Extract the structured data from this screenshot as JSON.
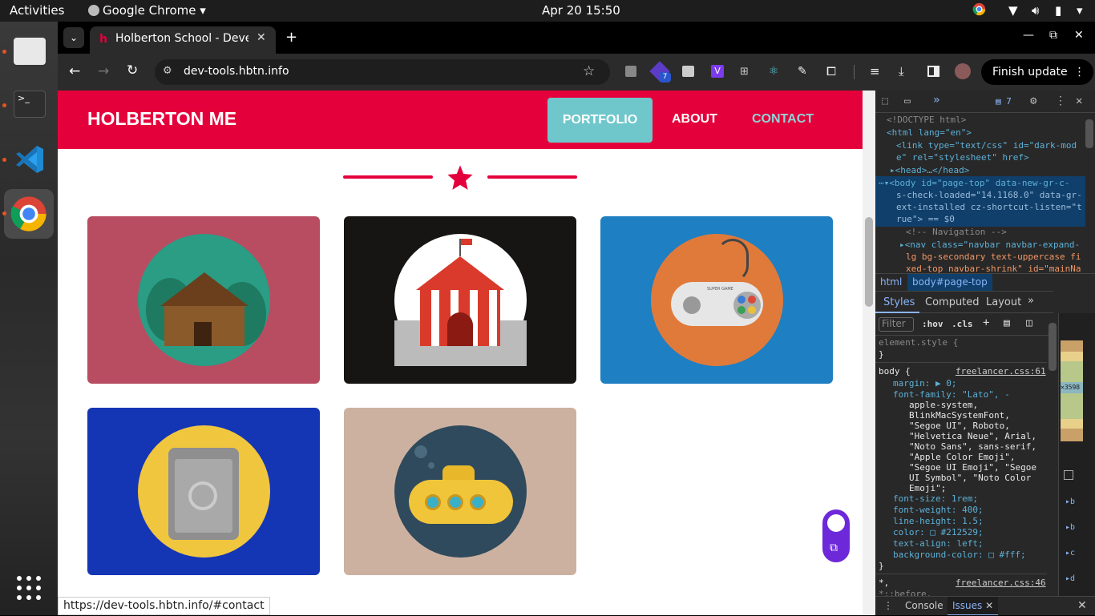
{
  "topbar": {
    "activities": "Activities",
    "app": "Google Chrome",
    "clock": "Apr 20  15:50"
  },
  "browser": {
    "tab_title": "Holberton School - Devel",
    "url": "dev-tools.hbtn.info",
    "finish_update": "Finish update",
    "extension_badge": "7",
    "status_url": "https://dev-tools.hbtn.info/#contact"
  },
  "site": {
    "brand": "HOLBERTON ME",
    "nav": [
      "PORTFOLIO",
      "ABOUT",
      "CONTACT"
    ],
    "tiles": [
      {
        "bg": "#b84d62",
        "circle": "#2a9d84",
        "icon": "cabin-icon"
      },
      {
        "bg": "#171414",
        "circle": "#ffffff",
        "icon": "circus-tent-icon"
      },
      {
        "bg": "#1e7fc2",
        "circle": "#e07a3a",
        "icon": "game-controller-icon"
      },
      {
        "bg": "#1436b5",
        "circle": "#f1c63f",
        "icon": "safe-icon"
      },
      {
        "bg": "#cdb1a0",
        "circle": "#2f4a5c",
        "icon": "submarine-icon"
      }
    ],
    "controller_label": "SUPER GAME"
  },
  "devtools": {
    "issues_count": "7",
    "elements": [
      "<!DOCTYPE html>",
      "<html lang=\"en\">",
      "<link type=\"text/css\" id=\"dark-mod",
      "e\" rel=\"stylesheet\" href>",
      "<head>…</head>",
      "<body id=\"page-top\" data-new-gr-c-",
      "s-check-loaded=\"14.1168.0\" data-gr-",
      "ext-installed cz-shortcut-listen=\"t",
      "rue\"> == $0",
      "<!-- Navigation -->",
      "<nav class=\"navbar navbar-expand-",
      "lg bg-secondary text-uppercase fi",
      "xed-top navbar-shrink\" id=\"mainNa"
    ],
    "crumbs": [
      "html",
      "body#page-top"
    ],
    "panel_tabs": [
      "Styles",
      "Computed",
      "Layout"
    ],
    "filter_placeholder": "Filter",
    "hov": ":hov",
    "cls": ".cls",
    "element_style": "element.style {",
    "close_brace": "}",
    "body_rule": "body {",
    "source": "freelancer.css:61",
    "source2": "freelancer.css:46",
    "decls": [
      "margin: ▶ 0;",
      "font-family: \"Lato\", -",
      "apple-system,",
      "BlinkMacSystemFont,",
      "\"Segoe UI\", Roboto,",
      "\"Helvetica Neue\", Arial,",
      "\"Noto Sans\", sans-serif,",
      "\"Apple Color Emoji\",",
      "\"Segoe UI Emoji\", \"Segoe",
      "UI Symbol\", \"Noto Color",
      "Emoji\";",
      "font-size: 1rem;",
      "font-weight: 400;",
      "line-height: 1.5;",
      "color: □ #212529;",
      "text-align: left;",
      "background-color: □ #fff;"
    ],
    "after_rule": "*,",
    "after_rule2": "*::before,",
    "box_value": "×3598",
    "drawer_tabs": [
      "Console",
      "Issues"
    ]
  }
}
